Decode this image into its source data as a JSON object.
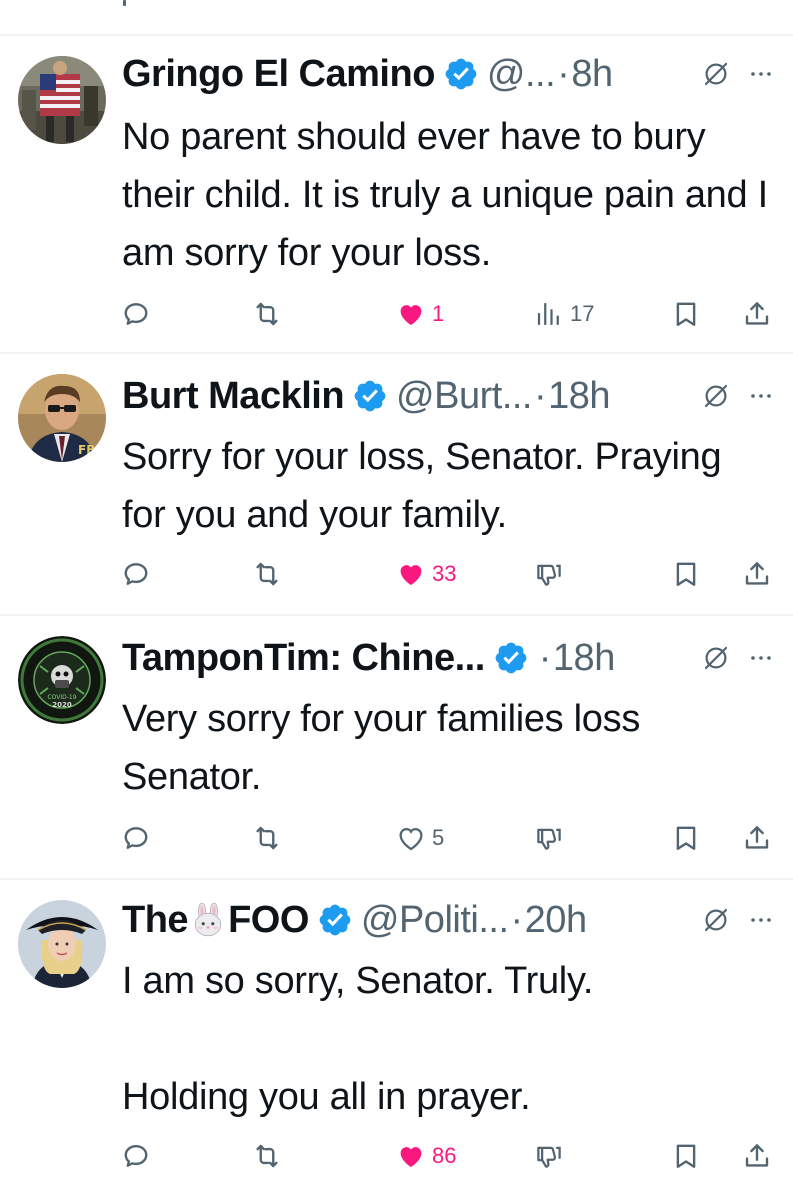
{
  "colors": {
    "text": "#0f1419",
    "secondary": "#536471",
    "like": "#f91880",
    "verified": "#1d9bf0",
    "divider": "#eff3f4"
  },
  "tweets": [
    {
      "name": "Gringo El Camino",
      "verified": true,
      "handle": "@...",
      "dot": "·",
      "time": "8h",
      "text": "No parent should ever have to bury their child. It is truly a unique pain and I am sorry for your loss.",
      "likes": "1",
      "liked": true,
      "views": "17",
      "show_views": true,
      "avatar": "avatar-flag-outfit"
    },
    {
      "name": "Burt Macklin",
      "verified": true,
      "handle": "@Burt...",
      "dot": "·",
      "time": "18h",
      "text": "Sorry for your loss, Senator. Praying for you and your family.",
      "likes": "33",
      "liked": true,
      "show_views": false,
      "avatar": "avatar-fbi-agent"
    },
    {
      "name": "TamponTim: Chine...",
      "verified": true,
      "handle": "",
      "dot": "·",
      "time": "18h",
      "text": "Very sorry for your families loss Senator.",
      "likes": "5",
      "liked": false,
      "show_views": false,
      "avatar": "avatar-covid-badge"
    },
    {
      "name_prefix": "The",
      "name_suffix": "FOO",
      "emoji": "rabbit-face-emoji",
      "verified": true,
      "handle": "@Politi...",
      "dot": "·",
      "time": "20h",
      "text": "I am so sorry, Senator. Truly.\n\nHolding you all in prayer.",
      "likes": "86",
      "liked": true,
      "show_views": false,
      "avatar": "avatar-tricorn-hat-woman"
    }
  ],
  "icons": {
    "reply": "reply-bubble-icon",
    "retweet": "retweet-icon",
    "like": "heart-icon",
    "views": "views-bars-icon",
    "downvote": "thumbs-down-icon",
    "bookmark": "bookmark-icon",
    "share": "share-icon",
    "grok": "slashed-circle-icon",
    "more": "more-dots-icon"
  }
}
